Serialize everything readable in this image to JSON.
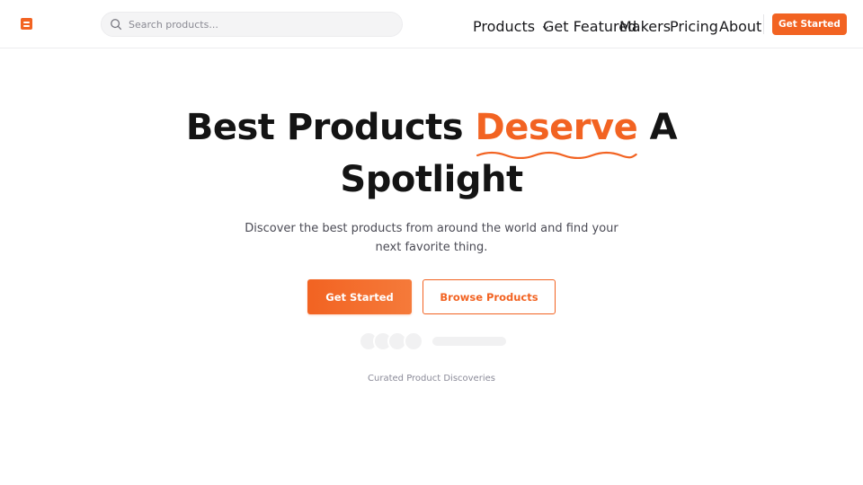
{
  "header": {
    "logo_icon": "logo-icon",
    "search": {
      "placeholder": "Search products...",
      "value": ""
    },
    "nav": [
      {
        "label": "Products",
        "has_dropdown": true
      },
      {
        "label": "Get Featured"
      },
      {
        "label": "Makers"
      },
      {
        "label": "Pricing"
      },
      {
        "label": "About"
      }
    ],
    "cta_label": "Get Started"
  },
  "hero": {
    "title_before": "Best Products ",
    "title_accent": "Deserve",
    "title_after_line1": " A",
    "title_line2": "Spotlight",
    "subtitle_line1": "Discover the best products from around the world and find your",
    "subtitle_line2": "next favorite thing.",
    "primary_button": "Get Started",
    "secondary_button": "Browse Products",
    "caption": "Curated Product Discoveries"
  },
  "colors": {
    "accent": "#f26322",
    "text": "#141414",
    "muted": "#4b4b55",
    "border": "#ececee"
  }
}
